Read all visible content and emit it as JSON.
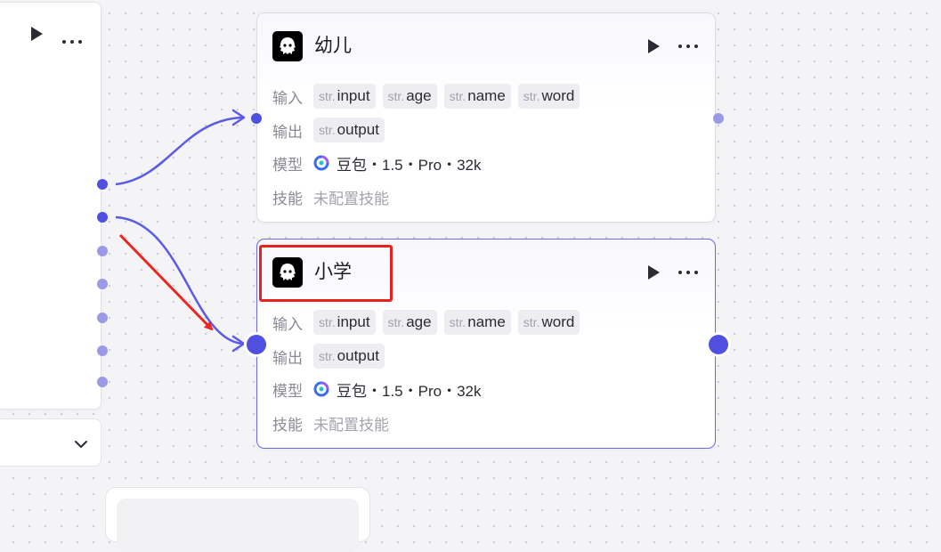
{
  "canvas": {
    "colors": {
      "edge": "#5b5be6",
      "port": "#5050e0",
      "port_light": "#9a9ae8",
      "highlight": "#e8211d",
      "arrow": "#ee2420"
    }
  },
  "left_node": {
    "run_icon": "play-icon",
    "more_icon": "more-icon",
    "dropdown_icon": "chevron-down-icon"
  },
  "nodes": [
    {
      "title": "幼儿",
      "icon": "bot-ghost-icon",
      "inputs_label": "输入",
      "inputs": [
        {
          "type": "str.",
          "name": "input"
        },
        {
          "type": "str.",
          "name": "age"
        },
        {
          "type": "str.",
          "name": "name"
        },
        {
          "type": "str.",
          "name": "word"
        }
      ],
      "outputs_label": "输出",
      "outputs": [
        {
          "type": "str.",
          "name": "output"
        }
      ],
      "model_label": "模型",
      "model": "豆包・1.5・Pro・32k",
      "skills_label": "技能",
      "skills": "未配置技能"
    },
    {
      "title": "小学",
      "icon": "bot-ghost-icon",
      "inputs_label": "输入",
      "inputs": [
        {
          "type": "str.",
          "name": "input"
        },
        {
          "type": "str.",
          "name": "age"
        },
        {
          "type": "str.",
          "name": "name"
        },
        {
          "type": "str.",
          "name": "word"
        }
      ],
      "outputs_label": "输出",
      "outputs": [
        {
          "type": "str.",
          "name": "output"
        }
      ],
      "model_label": "模型",
      "model": "豆包・1.5・Pro・32k",
      "skills_label": "技能",
      "skills": "未配置技能"
    }
  ]
}
